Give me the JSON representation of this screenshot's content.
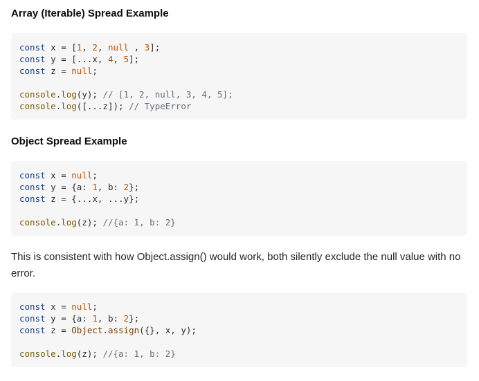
{
  "sections": {
    "array_heading": "Array (Iterable) Spread Example",
    "object_heading": "Object Spread Example",
    "paragraph": "This is consistent with how Object.assign() would work, both silently exclude the null value with no error."
  },
  "code_blocks": [
    {
      "lines": [
        [
          {
            "t": "const",
            "c": "kw"
          },
          {
            "t": " x = [",
            "c": "plain"
          },
          {
            "t": "1",
            "c": "num"
          },
          {
            "t": ", ",
            "c": "plain"
          },
          {
            "t": "2",
            "c": "num"
          },
          {
            "t": ", ",
            "c": "plain"
          },
          {
            "t": "null",
            "c": "lit"
          },
          {
            "t": " , ",
            "c": "plain"
          },
          {
            "t": "3",
            "c": "num"
          },
          {
            "t": "];",
            "c": "plain"
          }
        ],
        [
          {
            "t": "const",
            "c": "kw"
          },
          {
            "t": " y = [...x, ",
            "c": "plain"
          },
          {
            "t": "4",
            "c": "num"
          },
          {
            "t": ", ",
            "c": "plain"
          },
          {
            "t": "5",
            "c": "num"
          },
          {
            "t": "];",
            "c": "plain"
          }
        ],
        [
          {
            "t": "const",
            "c": "kw"
          },
          {
            "t": " z = ",
            "c": "plain"
          },
          {
            "t": "null",
            "c": "lit"
          },
          {
            "t": ";",
            "c": "plain"
          }
        ],
        [],
        [
          {
            "t": "console",
            "c": "fn"
          },
          {
            "t": ".",
            "c": "plain"
          },
          {
            "t": "log",
            "c": "fn"
          },
          {
            "t": "(y); ",
            "c": "plain"
          },
          {
            "t": "// [1, 2, null, 3, 4, 5];",
            "c": "cmt"
          }
        ],
        [
          {
            "t": "console",
            "c": "fn"
          },
          {
            "t": ".",
            "c": "plain"
          },
          {
            "t": "log",
            "c": "fn"
          },
          {
            "t": "([...z]); ",
            "c": "plain"
          },
          {
            "t": "// TypeError",
            "c": "cmt"
          }
        ]
      ]
    },
    {
      "lines": [
        [
          {
            "t": "const",
            "c": "kw"
          },
          {
            "t": " x = ",
            "c": "plain"
          },
          {
            "t": "null",
            "c": "lit"
          },
          {
            "t": ";",
            "c": "plain"
          }
        ],
        [
          {
            "t": "const",
            "c": "kw"
          },
          {
            "t": " y = {a: ",
            "c": "plain"
          },
          {
            "t": "1",
            "c": "num"
          },
          {
            "t": ", b: ",
            "c": "plain"
          },
          {
            "t": "2",
            "c": "num"
          },
          {
            "t": "};",
            "c": "plain"
          }
        ],
        [
          {
            "t": "const",
            "c": "kw"
          },
          {
            "t": " z = {...x, ...y};",
            "c": "plain"
          }
        ],
        [],
        [
          {
            "t": "console",
            "c": "fn"
          },
          {
            "t": ".",
            "c": "plain"
          },
          {
            "t": "log",
            "c": "fn"
          },
          {
            "t": "(z); ",
            "c": "plain"
          },
          {
            "t": "//{a: 1, b: 2}",
            "c": "cmt"
          }
        ]
      ]
    },
    {
      "lines": [
        [
          {
            "t": "const",
            "c": "kw"
          },
          {
            "t": " x = ",
            "c": "plain"
          },
          {
            "t": "null",
            "c": "lit"
          },
          {
            "t": ";",
            "c": "plain"
          }
        ],
        [
          {
            "t": "const",
            "c": "kw"
          },
          {
            "t": " y = {a: ",
            "c": "plain"
          },
          {
            "t": "1",
            "c": "num"
          },
          {
            "t": ", b: ",
            "c": "plain"
          },
          {
            "t": "2",
            "c": "num"
          },
          {
            "t": "};",
            "c": "plain"
          }
        ],
        [
          {
            "t": "const",
            "c": "kw"
          },
          {
            "t": " z = ",
            "c": "plain"
          },
          {
            "t": "Object",
            "c": "obj"
          },
          {
            "t": ".",
            "c": "plain"
          },
          {
            "t": "assign",
            "c": "obj"
          },
          {
            "t": "({}, x, y);",
            "c": "plain"
          }
        ],
        [],
        [
          {
            "t": "console",
            "c": "fn"
          },
          {
            "t": ".",
            "c": "plain"
          },
          {
            "t": "log",
            "c": "fn"
          },
          {
            "t": "(z); ",
            "c": "plain"
          },
          {
            "t": "//{a: 1, b: 2}",
            "c": "cmt"
          }
        ]
      ]
    }
  ]
}
